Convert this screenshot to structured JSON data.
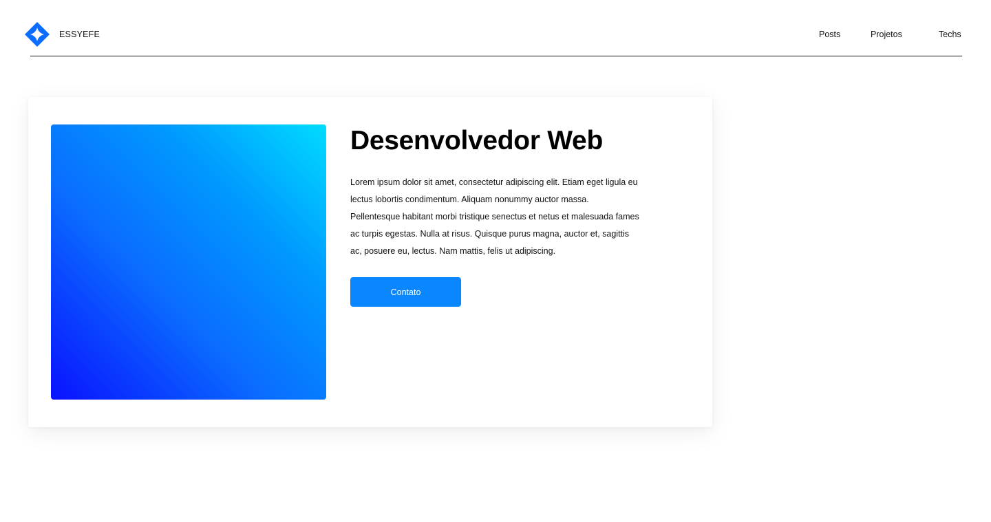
{
  "header": {
    "logo_icon": "diamond-star-logo-icon",
    "brand_name": "ESSYEFE",
    "nav": {
      "posts": "Posts",
      "projetos": "Projetos",
      "techs": "Techs"
    }
  },
  "hero": {
    "title": "Desenvolvedor Web",
    "description": "Lorem ipsum dolor sit amet, consectetur adipiscing elit. Etiam eget ligula eu lectus lobortis condimentum. Aliquam nonummy auctor massa. Pellentesque habitant morbi tristique senectus et netus et malesuada fames ac turpis egestas. Nulla at risus. Quisque purus magna, auctor et, sagittis ac, posuere eu, lectus. Nam mattis, felis ut adipiscing.",
    "button_label": "Contato",
    "gradient_colors": [
      "#00dcff",
      "#0a12ff"
    ]
  },
  "colors": {
    "accent": "#0a87ff",
    "logo": "#0a6dff"
  }
}
